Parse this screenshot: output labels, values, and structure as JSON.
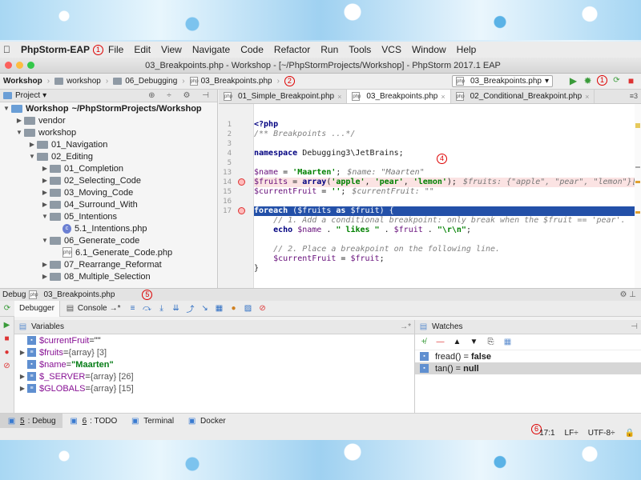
{
  "menu": {
    "apple": "",
    "app": "PhpStorm-EAP",
    "badge": "1",
    "items": [
      "File",
      "Edit",
      "View",
      "Navigate",
      "Code",
      "Refactor",
      "Run",
      "Tools",
      "VCS",
      "Window",
      "Help"
    ]
  },
  "window": {
    "title": "03_Breakpoints.php - Workshop - [~/PhpStormProjects/Workshop] - PhpStorm 2017.1 EAP"
  },
  "breadcrumbs": {
    "items": [
      "Workshop",
      "workshop",
      "06_Debugging",
      "03_Breakpoints.php"
    ],
    "badge": "2"
  },
  "run_config": {
    "value": "03_Breakpoints.php",
    "badge": "1"
  },
  "project": {
    "header": "Project",
    "tree": [
      {
        "label": "Workshop",
        "suffix": "~/PhpStormProjects/Workshop",
        "depth": 0,
        "kind": "folder-blue",
        "open": true
      },
      {
        "label": "vendor",
        "depth": 1,
        "kind": "folder",
        "open": false
      },
      {
        "label": "workshop",
        "depth": 1,
        "kind": "folder",
        "open": true
      },
      {
        "label": "01_Navigation",
        "depth": 2,
        "kind": "folder",
        "open": false
      },
      {
        "label": "02_Editing",
        "depth": 2,
        "kind": "folder",
        "open": true
      },
      {
        "label": "01_Completion",
        "depth": 3,
        "kind": "folder",
        "open": false
      },
      {
        "label": "02_Selecting_Code",
        "depth": 3,
        "kind": "folder",
        "open": false
      },
      {
        "label": "03_Moving_Code",
        "depth": 3,
        "kind": "folder",
        "open": false
      },
      {
        "label": "04_Surround_With",
        "depth": 3,
        "kind": "folder",
        "open": false
      },
      {
        "label": "05_Intentions",
        "depth": 3,
        "kind": "folder",
        "open": true
      },
      {
        "label": "5.1_Intentions.php",
        "depth": 4,
        "kind": "php-class"
      },
      {
        "label": "06_Generate_code",
        "depth": 3,
        "kind": "folder",
        "open": true
      },
      {
        "label": "6.1_Generate_Code.php",
        "depth": 4,
        "kind": "php-file"
      },
      {
        "label": "07_Rearrange_Reformat",
        "depth": 3,
        "kind": "folder",
        "open": false
      },
      {
        "label": "08_Multiple_Selection",
        "depth": 3,
        "kind": "folder",
        "open": false
      }
    ]
  },
  "tabs": [
    {
      "label": "01_Simple_Breakpoint.php"
    },
    {
      "label": "03_Breakpoints.php",
      "active": true
    },
    {
      "label": "02_Conditional_Breakpoint.php"
    }
  ],
  "tab_overflow": "≡3",
  "editor": {
    "badge": "4",
    "lines": [
      {
        "n": "1",
        "text": "<?php"
      },
      {
        "n": "2",
        "text": "/** Breakpoints ...*/"
      },
      {
        "n": "3",
        "text": ""
      },
      {
        "n": "4",
        "text": "namespace Debugging3\\JetBrains;"
      },
      {
        "n": "5",
        "text": ""
      },
      {
        "n": "13",
        "text": "$name = 'Maarten';",
        "inline": "$name: \"Maarten\""
      },
      {
        "n": "14",
        "text": "$fruits = array('apple', 'pear', 'lemon');",
        "inline": "$fruits: {\"apple\", \"pear\", \"lemon\"}[3]",
        "bp": true
      },
      {
        "n": "15",
        "text": "$currentFruit = '';",
        "inline": "$currentFruit: \"\""
      },
      {
        "n": "16",
        "text": ""
      },
      {
        "n": "17",
        "text": "foreach ($fruits as $fruit) {",
        "bp": true
      },
      {
        "n": "",
        "text": "    // 1. Add a conditional breakpoint: only break when the $fruit == 'pear'."
      },
      {
        "n": "",
        "text": "    echo $name . \" likes \" . $fruit . \"\\r\\n\";"
      },
      {
        "n": "",
        "text": ""
      },
      {
        "n": "",
        "text": "    // 2. Place a breakpoint on the following line."
      },
      {
        "n": "",
        "text": "    $currentFruit = $fruit;"
      },
      {
        "n": "",
        "text": "}"
      }
    ]
  },
  "debug": {
    "label": "Debug",
    "file": "03_Breakpoints.php",
    "badge": "5",
    "tabs": [
      "Debugger",
      "Console"
    ]
  },
  "variables": {
    "header": "Variables",
    "rows": [
      {
        "name": "$currentFruit",
        "eq": " = ",
        "value": "\"\"",
        "expand": false,
        "bold": false
      },
      {
        "name": "$fruits",
        "eq": " = ",
        "value": "{array} [3]",
        "expand": true
      },
      {
        "name": "$name",
        "eq": " = ",
        "value": "\"Maarten\"",
        "expand": false,
        "bold": true
      },
      {
        "name": "$_SERVER",
        "eq": " = ",
        "value": "{array} [26]",
        "expand": true
      },
      {
        "name": "$GLOBALS",
        "eq": " = ",
        "value": "{array} [15]",
        "expand": true
      }
    ]
  },
  "watches": {
    "header": "Watches",
    "rows": [
      {
        "expr": "fread()",
        "eq": " = ",
        "value": "false"
      },
      {
        "expr": "tan()",
        "eq": " = ",
        "value": "null",
        "selected": true
      }
    ]
  },
  "tool_tabs": [
    {
      "num": "5",
      "label": ": Debug",
      "active": true
    },
    {
      "num": "6",
      "label": ": TODO"
    },
    {
      "label": "Terminal"
    },
    {
      "label": "Docker"
    }
  ],
  "status": {
    "badge": "6",
    "position": "17:1",
    "line_sep": "LF÷",
    "encoding": "UTF-8÷"
  }
}
